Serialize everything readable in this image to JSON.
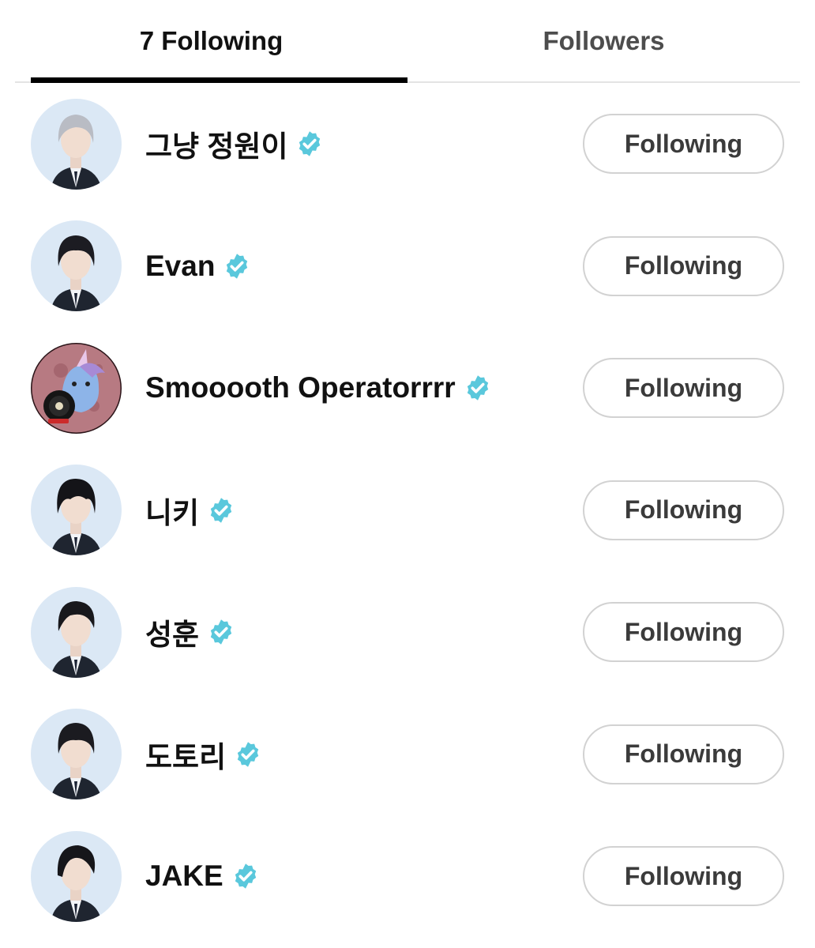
{
  "tabs": {
    "following_label": "7 Following",
    "followers_label": "Followers"
  },
  "colors": {
    "verified_badge": "#5ac8dc",
    "active_tab_underline": "#000000",
    "button_border": "#d2d2d2"
  },
  "users": [
    {
      "name": "그냥 정원이",
      "verified": true,
      "button_label": "Following",
      "avatar": "person-light-hair"
    },
    {
      "name": "Evan",
      "verified": true,
      "button_label": "Following",
      "avatar": "person-dark-hair"
    },
    {
      "name": "Smooooth Operatorrrr",
      "verified": true,
      "button_label": "Following",
      "avatar": "cartoon-unicorn-moon"
    },
    {
      "name": "니키",
      "verified": true,
      "button_label": "Following",
      "avatar": "person-dark-hair"
    },
    {
      "name": "성훈",
      "verified": true,
      "button_label": "Following",
      "avatar": "person-dark-hair"
    },
    {
      "name": "도토리",
      "verified": true,
      "button_label": "Following",
      "avatar": "person-dark-hair"
    },
    {
      "name": "JAKE",
      "verified": true,
      "button_label": "Following",
      "avatar": "person-dark-hair"
    }
  ]
}
